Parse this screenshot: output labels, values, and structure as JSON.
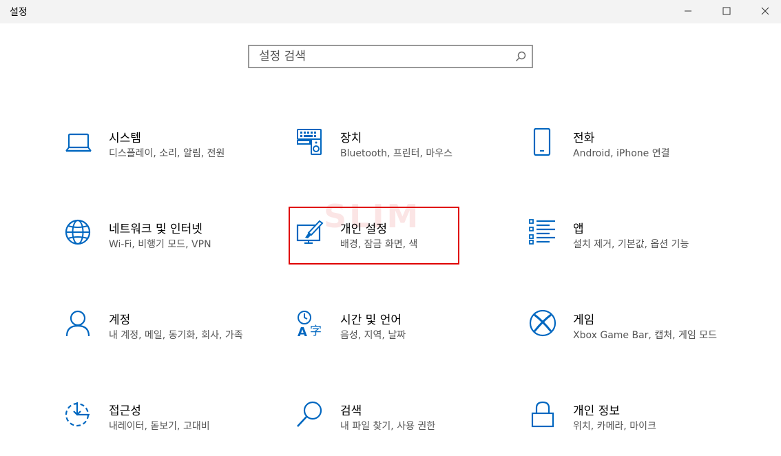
{
  "window": {
    "title": "설정",
    "accent": "#0067c0"
  },
  "search": {
    "placeholder": "설정 검색",
    "value": ""
  },
  "watermark": "SLIM",
  "tiles": [
    {
      "title": "시스템",
      "subtitle": "디스플레이, 소리, 알림, 전원",
      "icon": "laptop-icon"
    },
    {
      "title": "장치",
      "subtitle": "Bluetooth, 프린터, 마우스",
      "icon": "devices-icon"
    },
    {
      "title": "전화",
      "subtitle": "Android, iPhone 연결",
      "icon": "phone-icon"
    },
    {
      "title": "네트워크 및 인터넷",
      "subtitle": "Wi-Fi, 비행기 모드, VPN",
      "icon": "globe-icon"
    },
    {
      "title": "개인 설정",
      "subtitle": "배경, 잠금 화면, 색",
      "icon": "personalization-icon"
    },
    {
      "title": "앱",
      "subtitle": "설치 제거, 기본값, 옵션 기능",
      "icon": "apps-list-icon"
    },
    {
      "title": "계정",
      "subtitle": "내 계정, 메일, 동기화, 회사, 가족",
      "icon": "person-icon"
    },
    {
      "title": "시간 및 언어",
      "subtitle": "음성, 지역, 날짜",
      "icon": "time-language-icon"
    },
    {
      "title": "게임",
      "subtitle": "Xbox Game Bar, 캡처, 게임 모드",
      "icon": "xbox-icon"
    },
    {
      "title": "접근성",
      "subtitle": "내레이터, 돋보기, 고대비",
      "icon": "ease-of-access-icon"
    },
    {
      "title": "검색",
      "subtitle": "내 파일 찾기, 사용 권한",
      "icon": "search-icon"
    },
    {
      "title": "개인 정보",
      "subtitle": "위치, 카메라, 마이크",
      "icon": "lock-icon"
    }
  ]
}
